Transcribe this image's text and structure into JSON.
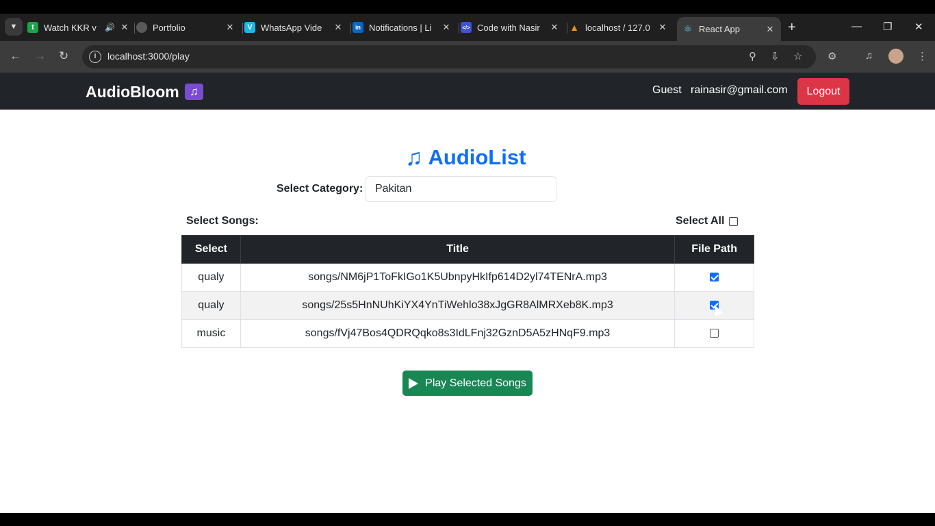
{
  "browser": {
    "tabs": [
      {
        "label": "Watch KKR v",
        "favicon": "t",
        "fav_color": "#1aa34a",
        "has_audio": true
      },
      {
        "label": "Portfolio",
        "favicon": "globe-icon",
        "fav_color": "#5a5a5a"
      },
      {
        "label": "WhatsApp Vide",
        "favicon": "V",
        "fav_color": "#1ab7ea"
      },
      {
        "label": "Notifications | Li",
        "favicon": "in",
        "fav_color": "#0a66c2"
      },
      {
        "label": "Code with Nasir",
        "favicon": "</>",
        "fav_color": "#3d52d5"
      },
      {
        "label": "localhost / 127.0",
        "favicon": "sail-icon",
        "fav_color": "#f29111"
      },
      {
        "label": "React App",
        "favicon": "react-icon",
        "fav_color": "#61dafb",
        "active": true
      }
    ],
    "url": "localhost:3000/play"
  },
  "app": {
    "brand": "AudioBloom",
    "user_role": "Guest",
    "user_email": "rainasir@gmail.com",
    "logout_label": "Logout"
  },
  "audiolist": {
    "title": "AudioList",
    "category_label": "Select Category:",
    "category_value": "Pakitan",
    "songs_label": "Select Songs:",
    "select_all_label": "Select All",
    "select_all_checked": false,
    "columns": [
      "Select",
      "Title",
      "File Path"
    ],
    "rows": [
      {
        "select": "qualy",
        "title": "songs/NM6jP1ToFkIGo1K5UbnpyHkIfp614D2yl74TENrA.mp3",
        "checked": true
      },
      {
        "select": "qualy",
        "title": "songs/25s5HnNUhKiYX4YnTiWehlo38xJgGR8AlMRXeb8K.mp3",
        "checked": true
      },
      {
        "select": "music",
        "title": "songs/fVj47Bos4QDRQqko8s3IdLFnj32GznD5A5zHNqF9.mp3",
        "checked": false
      }
    ],
    "play_label": "Play Selected Songs"
  },
  "colors": {
    "primary": "#0d6efd",
    "danger": "#dc3545",
    "success": "#198754",
    "navbar": "#212529"
  }
}
